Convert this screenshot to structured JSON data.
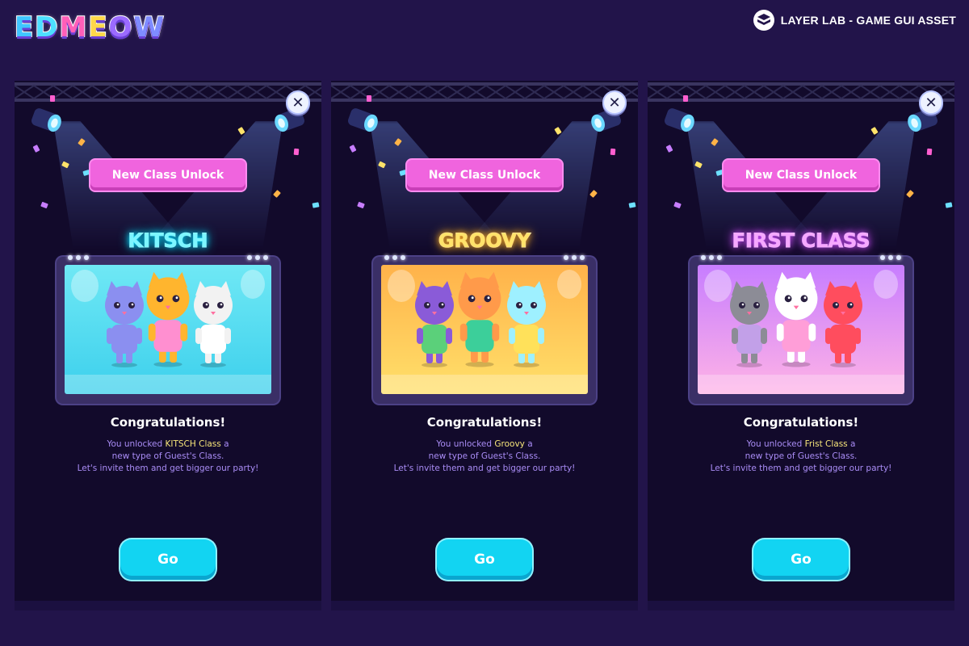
{
  "header": {
    "logo_letters": [
      "E",
      "D",
      "M",
      "E",
      "O",
      "W"
    ],
    "logo_colors": [
      "#3fc6ff",
      "#4de0ff",
      "#ff5fb8",
      "#ffd84a",
      "#9b6bff",
      "#7f8cff"
    ],
    "brand_label": "LAYER LAB - GAME GUI ASSET"
  },
  "panels": [
    {
      "ribbon_label": "New Class Unlock",
      "class_name": "KITSCH",
      "title_color": "#7df6ff",
      "title_glow": "#00e0ff",
      "screen_bg": [
        "#6fe8f5",
        "#3dd0ec"
      ],
      "congrats": "Congratulations!",
      "desc_pre": "You unlocked ",
      "desc_highlight": "KITSCH Class",
      "desc_post": " a",
      "desc_line2": "new type of Guest's Class.",
      "desc_line3": "Let's invite them and get bigger our party!",
      "go_label": "Go"
    },
    {
      "ribbon_label": "New Class Unlock",
      "class_name": "GROOVY",
      "title_color": "#ffe36a",
      "title_glow": "#ffb020",
      "screen_bg": [
        "#ffb24a",
        "#ffe06a"
      ],
      "congrats": "Congratulations!",
      "desc_pre": "You unlocked ",
      "desc_highlight": "Groovy",
      "desc_post": " a",
      "desc_line2": "new type of Guest's Class.",
      "desc_line3": "Let's invite them and get bigger our party!",
      "go_label": "Go"
    },
    {
      "ribbon_label": "New Class Unlock",
      "class_name": "FIRST CLASS",
      "title_color": "#f6a8ff",
      "title_glow": "#d04dff",
      "screen_bg": [
        "#c77dff",
        "#ffb3e6"
      ],
      "congrats": "Congratulations!",
      "desc_pre": "You unlocked ",
      "desc_highlight": "Frist Class",
      "desc_post": " a",
      "desc_line2": "new type of Guest's Class.",
      "desc_line3": "Let's invite them and get bigger our party!",
      "go_label": "Go"
    }
  ]
}
